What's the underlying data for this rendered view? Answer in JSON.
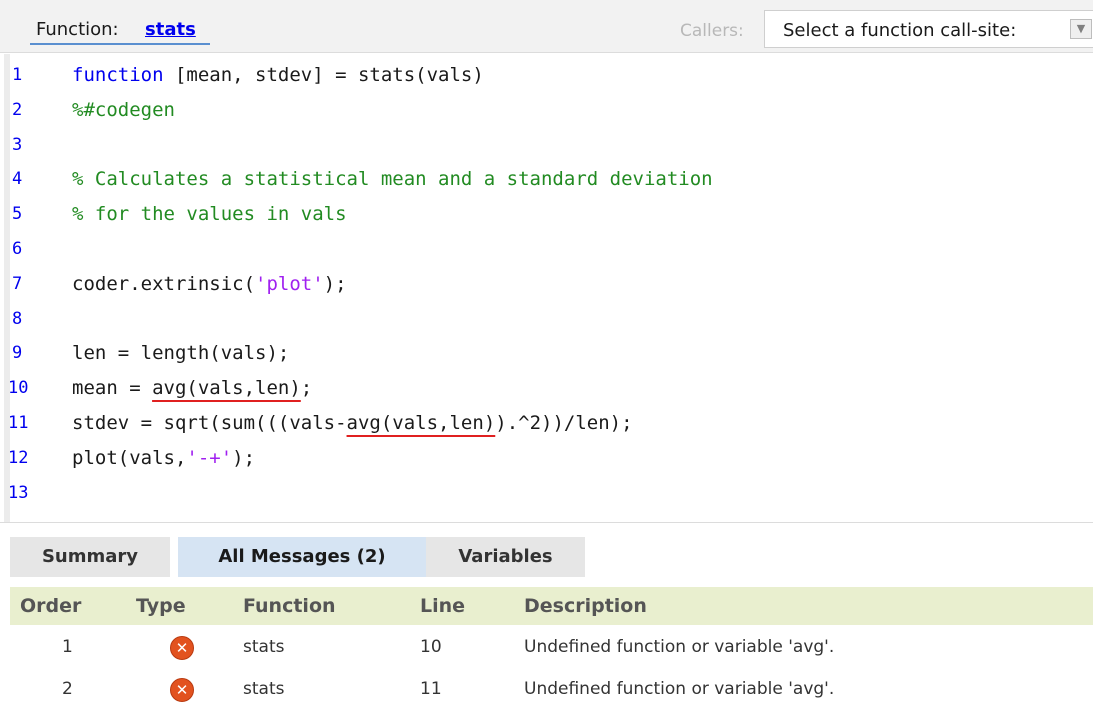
{
  "header": {
    "function_label": "Function:",
    "function_name": "stats",
    "callers_label": "Callers:",
    "callsite_select": "Select a function call-site:"
  },
  "code": {
    "lines": [
      {
        "n": "1",
        "parts": [
          {
            "t": "function",
            "c": "kw"
          },
          {
            "t": " [mean, stdev] = stats(vals)",
            "c": ""
          }
        ]
      },
      {
        "n": "2",
        "parts": [
          {
            "t": "%#codegen",
            "c": "cm"
          }
        ]
      },
      {
        "n": "3",
        "parts": []
      },
      {
        "n": "4",
        "parts": [
          {
            "t": "% Calculates a statistical mean and a standard deviation",
            "c": "cm"
          }
        ]
      },
      {
        "n": "5",
        "parts": [
          {
            "t": "% for the values in vals",
            "c": "cm"
          }
        ]
      },
      {
        "n": "6",
        "parts": []
      },
      {
        "n": "7",
        "parts": [
          {
            "t": "coder.extrinsic(",
            "c": ""
          },
          {
            "t": "'plot'",
            "c": "st"
          },
          {
            "t": ");",
            "c": ""
          }
        ]
      },
      {
        "n": "8",
        "parts": []
      },
      {
        "n": "9",
        "parts": [
          {
            "t": "len = length(vals);",
            "c": ""
          }
        ]
      },
      {
        "n": "10",
        "parts": [
          {
            "t": "mean = ",
            "c": ""
          },
          {
            "t": "avg(vals,len)",
            "c": "err"
          },
          {
            "t": ";",
            "c": ""
          }
        ]
      },
      {
        "n": "11",
        "parts": [
          {
            "t": "stdev = sqrt(sum(((vals-",
            "c": ""
          },
          {
            "t": "avg(vals,len)",
            "c": "err"
          },
          {
            "t": ").^2))/len);",
            "c": ""
          }
        ]
      },
      {
        "n": "12",
        "parts": [
          {
            "t": "plot(vals,",
            "c": ""
          },
          {
            "t": "'-+'",
            "c": "st"
          },
          {
            "t": ");",
            "c": ""
          }
        ]
      },
      {
        "n": "13",
        "parts": []
      }
    ]
  },
  "tabs": [
    {
      "label": "Summary"
    },
    {
      "label": "All Messages (2)"
    },
    {
      "label": "Variables"
    }
  ],
  "messages": {
    "columns": [
      "Order",
      "Type",
      "Function",
      "Line",
      "Description"
    ],
    "rows": [
      {
        "order": "1",
        "type_icon": "error-icon",
        "function": "stats",
        "line": "10",
        "description": "Undefined function or variable 'avg'."
      },
      {
        "order": "2",
        "type_icon": "error-icon",
        "function": "stats",
        "line": "11",
        "description": "Undefined function or variable 'avg'."
      }
    ]
  },
  "colors": {
    "keyword": "#0000ee",
    "comment": "#228b22",
    "string": "#a020f0",
    "error_underline": "#e02020",
    "table_header_bg": "#e9efcf",
    "active_tab_bg": "#d6e4f3",
    "error_icon": "#e2521f"
  }
}
